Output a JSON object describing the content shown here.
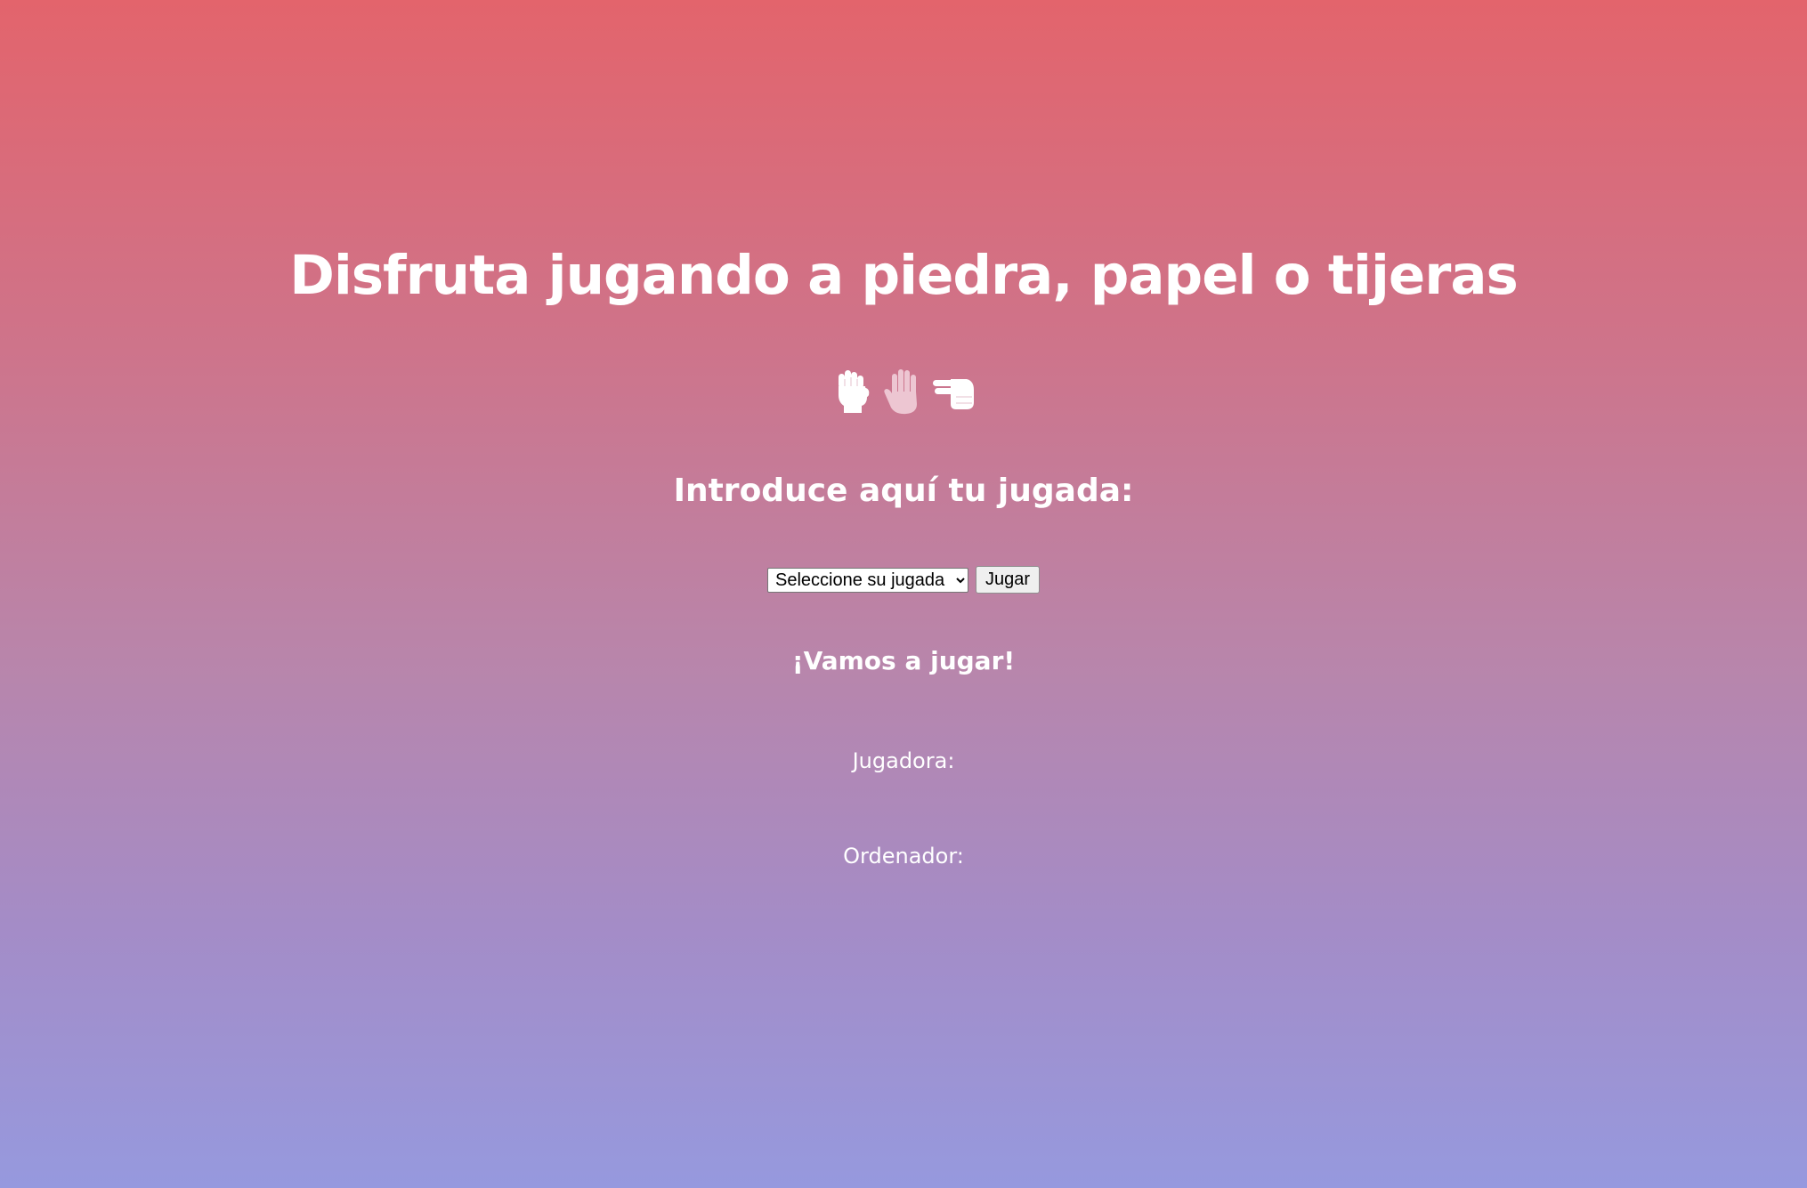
{
  "title": "Disfruta jugando a piedra, papel o tijeras",
  "icons": [
    "fist-icon",
    "open-hand-icon",
    "victory-hand-icon"
  ],
  "prompt": "Introduce aquí tu jugada:",
  "move_select": {
    "selected": "Seleccione su jugada",
    "options": [
      "Seleccione su jugada"
    ]
  },
  "play_button": "Jugar",
  "status": "¡Vamos a jugar!",
  "player_label": "Jugadora:",
  "computer_label": "Ordenador:",
  "colors": {
    "gradient_top": "#e3646c",
    "gradient_bottom": "#9699de",
    "text": "#ffffff"
  }
}
